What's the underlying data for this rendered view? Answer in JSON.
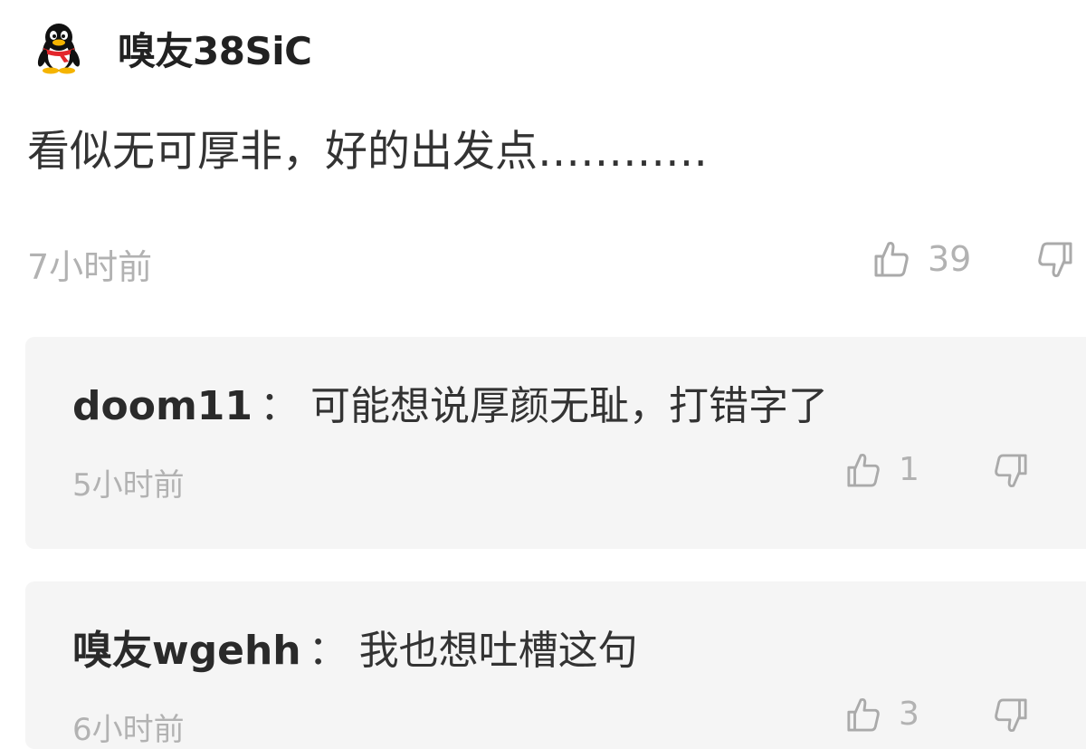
{
  "comment": {
    "username": "嗅友38SiC",
    "text": "看似无可厚非，好的出发点…………",
    "time": "7小时前",
    "likes": "39"
  },
  "replies": [
    {
      "author": "doom11",
      "separator": "：",
      "text": "可能想说厚颜无耻，打错字了",
      "time": "5小时前",
      "likes": "1"
    },
    {
      "author": "嗅友wgehh",
      "separator": "：",
      "text": "我也想吐槽这句",
      "time": "6小时前",
      "likes": "3"
    }
  ],
  "icons": {
    "avatar": "qq-penguin-avatar",
    "like": "thumbs-up-icon",
    "dislike": "thumbs-down-icon"
  },
  "colors": {
    "text_primary": "#222222",
    "text_muted": "#b2b2b2",
    "reply_background": "#f5f5f5"
  }
}
